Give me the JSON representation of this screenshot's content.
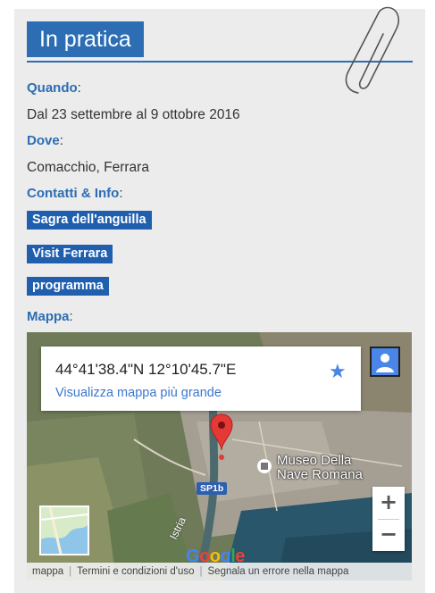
{
  "section_title": "In pratica",
  "when": {
    "label": "Quando",
    "value": "Dal 23 settembre al 9 ottobre 2016"
  },
  "where": {
    "label": "Dove",
    "value": "Comacchio, Ferrara"
  },
  "contacts": {
    "label": "Contatti & Info",
    "links": [
      "Sagra dell'anguilla",
      "Visit Ferrara",
      "programma"
    ]
  },
  "map_section": {
    "label": "Mappa",
    "coordinates": "44°41'38.4\"N 12°10'45.7\"E",
    "view_larger": "Visualizza mappa più grande",
    "poi_name": "Museo Della Nave Romana",
    "road_label": "SP1b",
    "street_label": "Istria",
    "google_logo": "Google",
    "footer": [
      "mappa",
      "Termini e condizioni d'uso",
      "Segnala un errore nella mappa"
    ],
    "zoom_in": "+",
    "zoom_out": "−"
  },
  "colors": {
    "accent": "#2c6db3",
    "tag_bg": "#1f5fae",
    "panel_bg": "#ececec",
    "map_link": "#3b77cf"
  },
  "icons": [
    "paperclip-icon",
    "star-icon",
    "person-icon",
    "map-pin-icon",
    "museum-icon",
    "map-thumbnail-icon"
  ]
}
